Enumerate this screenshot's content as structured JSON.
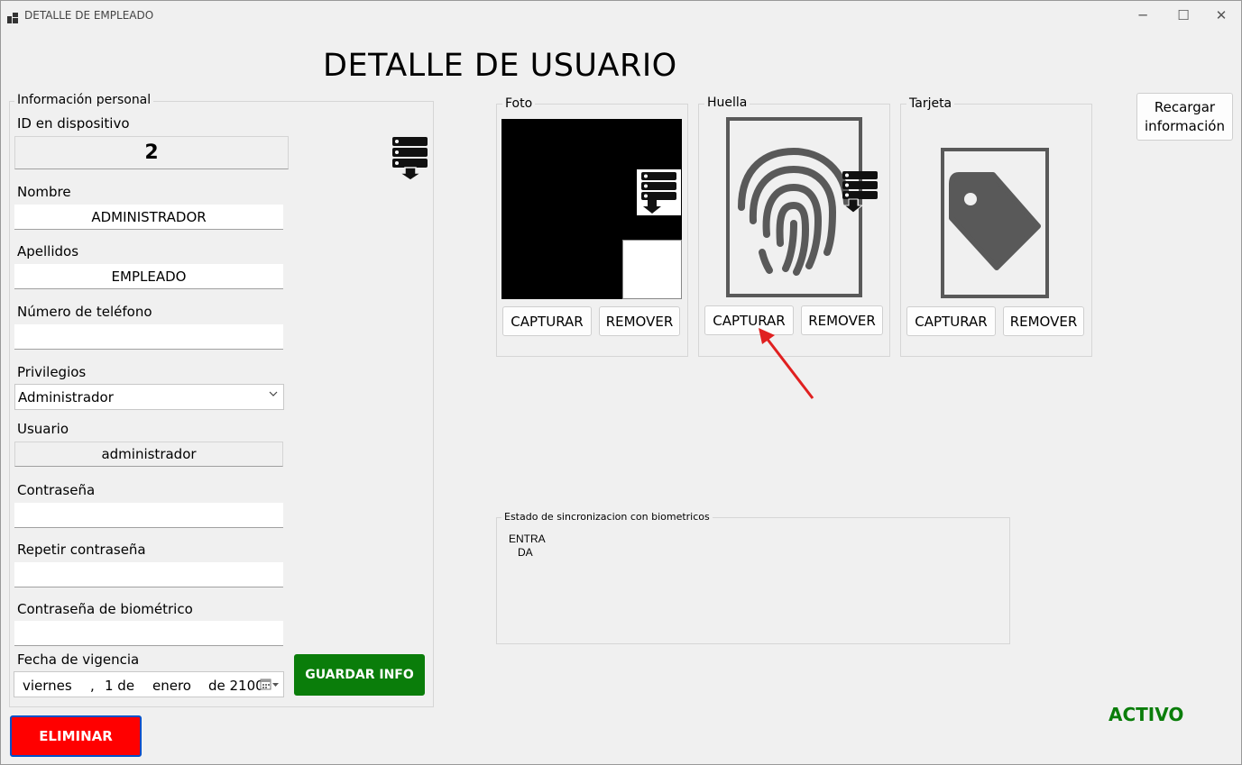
{
  "window": {
    "title": "DETALLE DE EMPLEADO",
    "minimize": "─",
    "maximize": "☐",
    "close": "✕"
  },
  "page_title": "DETALLE DE USUARIO",
  "personal": {
    "group_label": "Información personal",
    "device_id_label": "ID en dispositivo",
    "device_id_value": "2",
    "name_label": "Nombre",
    "name_value": "ADMINISTRADOR",
    "lastname_label": "Apellidos",
    "lastname_value": "EMPLEADO",
    "phone_label": "Número de teléfono",
    "phone_value": "",
    "privileges_label": "Privilegios",
    "privileges_value": "Administrador",
    "user_label": "Usuario",
    "user_value": "administrador",
    "password_label": "Contraseña",
    "password_value": "",
    "repeat_password_label": "Repetir contraseña",
    "repeat_password_value": "",
    "bio_password_label": "Contraseña de biométrico",
    "bio_password_value": "",
    "expiry_label": "Fecha de vigencia",
    "expiry_date": {
      "weekday": "viernes",
      "sep": ",",
      "day": "1 de",
      "month": "enero",
      "year": "de 2100"
    }
  },
  "buttons": {
    "save": "GUARDAR INFO",
    "delete": "ELIMINAR",
    "reload": "Recargar información"
  },
  "photo": {
    "label": "Foto",
    "capture": "CAPTURAR",
    "remove": "REMOVER"
  },
  "fingerprint": {
    "label": "Huella",
    "capture": "CAPTURAR",
    "remove": "REMOVER"
  },
  "card": {
    "label": "Tarjeta",
    "capture": "CAPTURAR",
    "remove": "REMOVER"
  },
  "sync": {
    "label": "Estado de sincronizacion con biometricos",
    "text": "ENTRA\n   DA"
  },
  "status": "ACTIVO",
  "colors": {
    "save_button": "#0a7d0a",
    "delete_button": "#ff0000",
    "status_text": "#0a7d0a",
    "annotation_arrow": "#e02020"
  }
}
